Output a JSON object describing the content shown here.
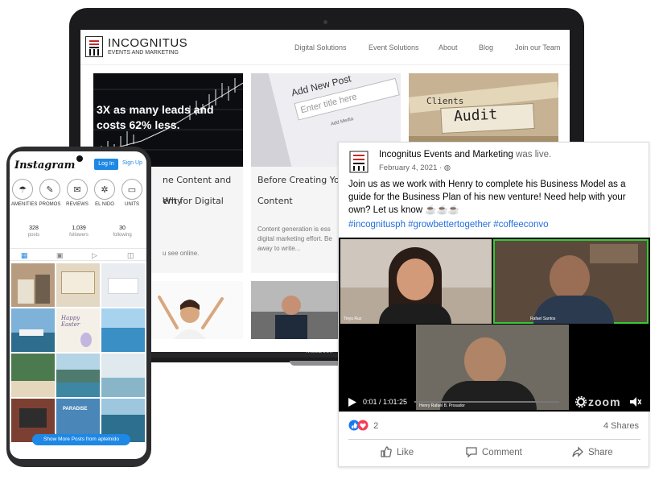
{
  "website": {
    "brand_name": "INCOGNITUS",
    "brand_tagline": "EVENTS AND MARKETING",
    "nav": [
      "Digital Solutions",
      "Event Solutions",
      "About",
      "Blog",
      "Join our Team"
    ],
    "cards": [
      {
        "image_caption": "3X as many leads and costs 62% less.",
        "title_lines": [
          "ne Content and Why",
          "ent for Digital"
        ],
        "excerpt": "u see online."
      },
      {
        "image_caption": "Add New Post",
        "image_field": "Enter title here",
        "image_small": "Add Media",
        "title_lines": [
          "Before Creating You",
          "Content"
        ],
        "excerpt_lines": [
          "Content generation is ess",
          "digital marketing effort. Be",
          "away to write..."
        ]
      },
      {
        "image_caption": "Audit",
        "image_small": "Clients"
      }
    ],
    "device_label": "MacBook"
  },
  "instagram": {
    "logo": "Instagram",
    "login_label": "Log In",
    "signup_label": "Sign Up",
    "highlights": [
      {
        "label": "AMENITIES",
        "icon": "umbrella-icon"
      },
      {
        "label": "PROMOS",
        "icon": "tag-icon"
      },
      {
        "label": "REVIEWS",
        "icon": "chat-icon"
      },
      {
        "label": "EL NIDO",
        "icon": "palm-tree-icon"
      },
      {
        "label": "UNITS",
        "icon": "bed-icon"
      }
    ],
    "stats": [
      {
        "value": "328",
        "label": "posts"
      },
      {
        "value": "1,039",
        "label": "followers"
      },
      {
        "value": "30",
        "label": "following"
      }
    ],
    "grid_captions": {
      "easter": "Happy Easter",
      "paradise": "PARADISE"
    },
    "more_label": "Show More Posts from aptelnido"
  },
  "facebook": {
    "author": "Incognitus Events and Marketing",
    "activity": "was live.",
    "date": "February 4, 2021 ·",
    "body": "Join us as we work with Henry to complete his Business Model as a guide for the Business Plan of his new venture! Need help with your own? Let us know ☕☕☕",
    "hashtags": "#incognitusph #growbettertogether #coffeeconvo",
    "video": {
      "participants": [
        "Tinyu Ruz",
        "Rafael Santos",
        "Henry Rafael B. Prosador"
      ],
      "time": "0:01 / 1:01:25",
      "watermark": "zoom",
      "progress": 0.0
    },
    "reaction_count": "2",
    "shares": "4 Shares",
    "actions": [
      "Like",
      "Comment",
      "Share"
    ]
  },
  "colors": {
    "accent_blue": "#1e88e5",
    "fb_link": "#216fdb",
    "brand_red": "#c62828",
    "zoom_highlight": "#37c837"
  }
}
